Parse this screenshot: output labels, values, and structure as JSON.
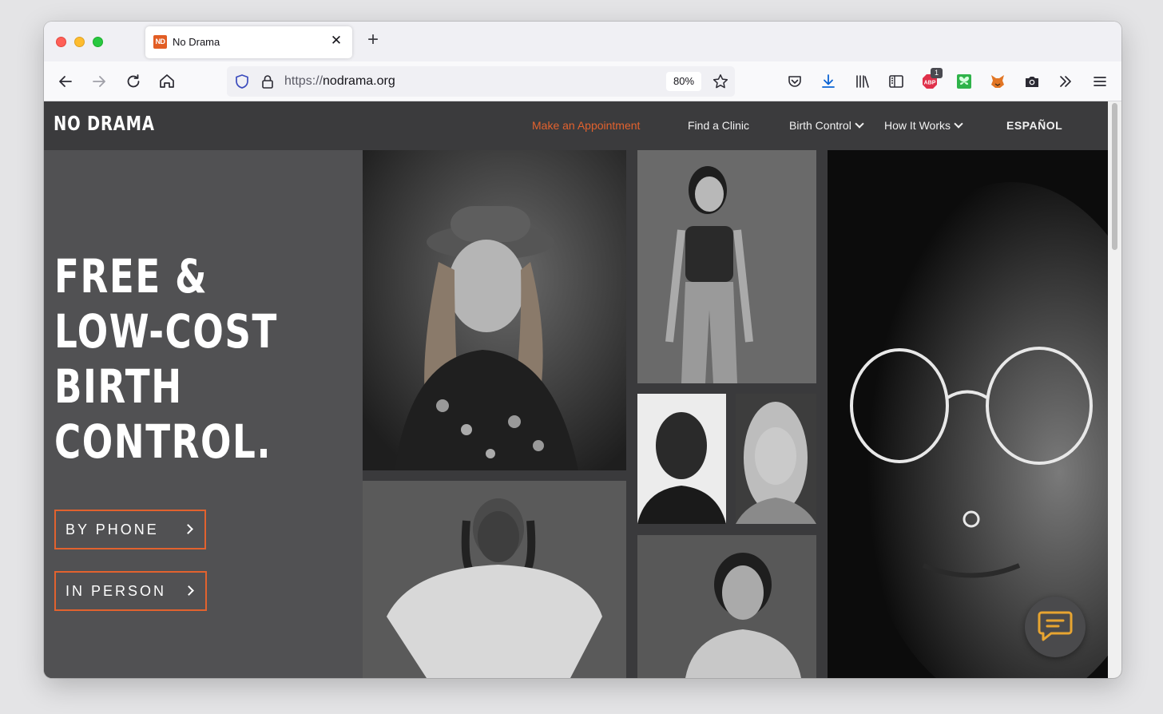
{
  "browser": {
    "tab_title": "No Drama",
    "tab_favicon": "ND",
    "url_scheme": "https://",
    "url_host": "nodrama.org",
    "zoom": "80%",
    "extension_badge": "1"
  },
  "site": {
    "logo": "NO DRAMA",
    "nav": {
      "appointment": "Make an Appointment",
      "find_clinic": "Find a Clinic",
      "birth_control": "Birth Control",
      "how_it_works": "How It Works",
      "espanol": "ESPAÑOL"
    },
    "hero": {
      "line1": "FREE &",
      "line2": "LOW-COST",
      "line3": "BIRTH",
      "line4": "CONTROL.",
      "by_phone": "BY PHONE",
      "in_person": "IN PERSON"
    }
  },
  "colors": {
    "accent": "#e2622e",
    "header_bg": "#3b3b3d",
    "hero_bg": "#515153"
  },
  "icons": [
    "back-arrow-icon",
    "forward-arrow-icon",
    "reload-icon",
    "home-icon",
    "shield-icon",
    "lock-icon",
    "star-icon",
    "pocket-icon",
    "download-icon",
    "library-icon",
    "sidebar-icon",
    "adblock-icon",
    "butterfly-icon",
    "fox-icon",
    "camera-icon",
    "overflow-icon",
    "menu-icon",
    "chat-icon"
  ]
}
